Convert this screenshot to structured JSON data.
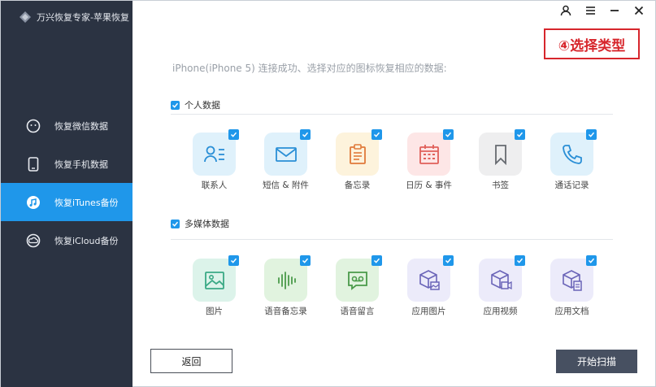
{
  "app": {
    "title": "万兴恢复专家-苹果恢复"
  },
  "sidebar": {
    "items": [
      {
        "label": "恢复微信数据",
        "icon": "wechat-icon",
        "active": false
      },
      {
        "label": "恢复手机数据",
        "icon": "phone-icon",
        "active": false
      },
      {
        "label": "恢复iTunes备份",
        "icon": "itunes-icon",
        "active": true
      },
      {
        "label": "恢复iCloud备份",
        "icon": "icloud-icon",
        "active": false
      }
    ]
  },
  "window_controls": {
    "user": "user-icon",
    "menu": "menu-icon",
    "minimize": "minimize-icon",
    "close": "close-icon"
  },
  "annotation": {
    "text": "④选择类型",
    "color": "#d7262c"
  },
  "main": {
    "subtitle": "iPhone(iPhone  5) 连接成功、选择对应的图标恢复相应的数据:",
    "sections": [
      {
        "title": "个人数据",
        "checked": true,
        "items": [
          {
            "label": "联系人",
            "icon": "contacts-icon",
            "bg": "#dff1fb",
            "fg": "#2a8fd6",
            "checked": true
          },
          {
            "label": "短信 & 附件",
            "icon": "message-icon",
            "bg": "#dff1fb",
            "fg": "#2a8fd6",
            "checked": true
          },
          {
            "label": "备忘录",
            "icon": "notes-icon",
            "bg": "#fdf3dc",
            "fg": "#e07a3a",
            "checked": true
          },
          {
            "label": "日历 & 事件",
            "icon": "calendar-icon",
            "bg": "#fde6e6",
            "fg": "#e0605a",
            "checked": true
          },
          {
            "label": "书签",
            "icon": "bookmark-icon",
            "bg": "#eeeeef",
            "fg": "#666a70",
            "checked": true
          },
          {
            "label": "通话记录",
            "icon": "call-log-icon",
            "bg": "#dff1fb",
            "fg": "#2a8fd6",
            "checked": true
          }
        ]
      },
      {
        "title": "多媒体数据",
        "checked": true,
        "items": [
          {
            "label": "图片",
            "icon": "photo-icon",
            "bg": "#dcf3ea",
            "fg": "#3aa985",
            "checked": true
          },
          {
            "label": "语音备忘录",
            "icon": "voice-memo-icon",
            "bg": "#e1f3df",
            "fg": "#4a9a4a",
            "checked": true
          },
          {
            "label": "语音留言",
            "icon": "voicemail-icon",
            "bg": "#e1f3df",
            "fg": "#4a9a4a",
            "checked": true
          },
          {
            "label": "应用图片",
            "icon": "app-photo-icon",
            "bg": "#ecebfa",
            "fg": "#6a64b8",
            "checked": true
          },
          {
            "label": "应用视频",
            "icon": "app-video-icon",
            "bg": "#ecebfa",
            "fg": "#6a64b8",
            "checked": true
          },
          {
            "label": "应用文档",
            "icon": "app-document-icon",
            "bg": "#ecebfa",
            "fg": "#6a64b8",
            "checked": true
          }
        ]
      }
    ]
  },
  "buttons": {
    "back": "返回",
    "scan": "开始扫描"
  },
  "colors": {
    "sidebar_bg": "#2b3342",
    "accent": "#1f97ea",
    "scan_bg": "#475061"
  }
}
